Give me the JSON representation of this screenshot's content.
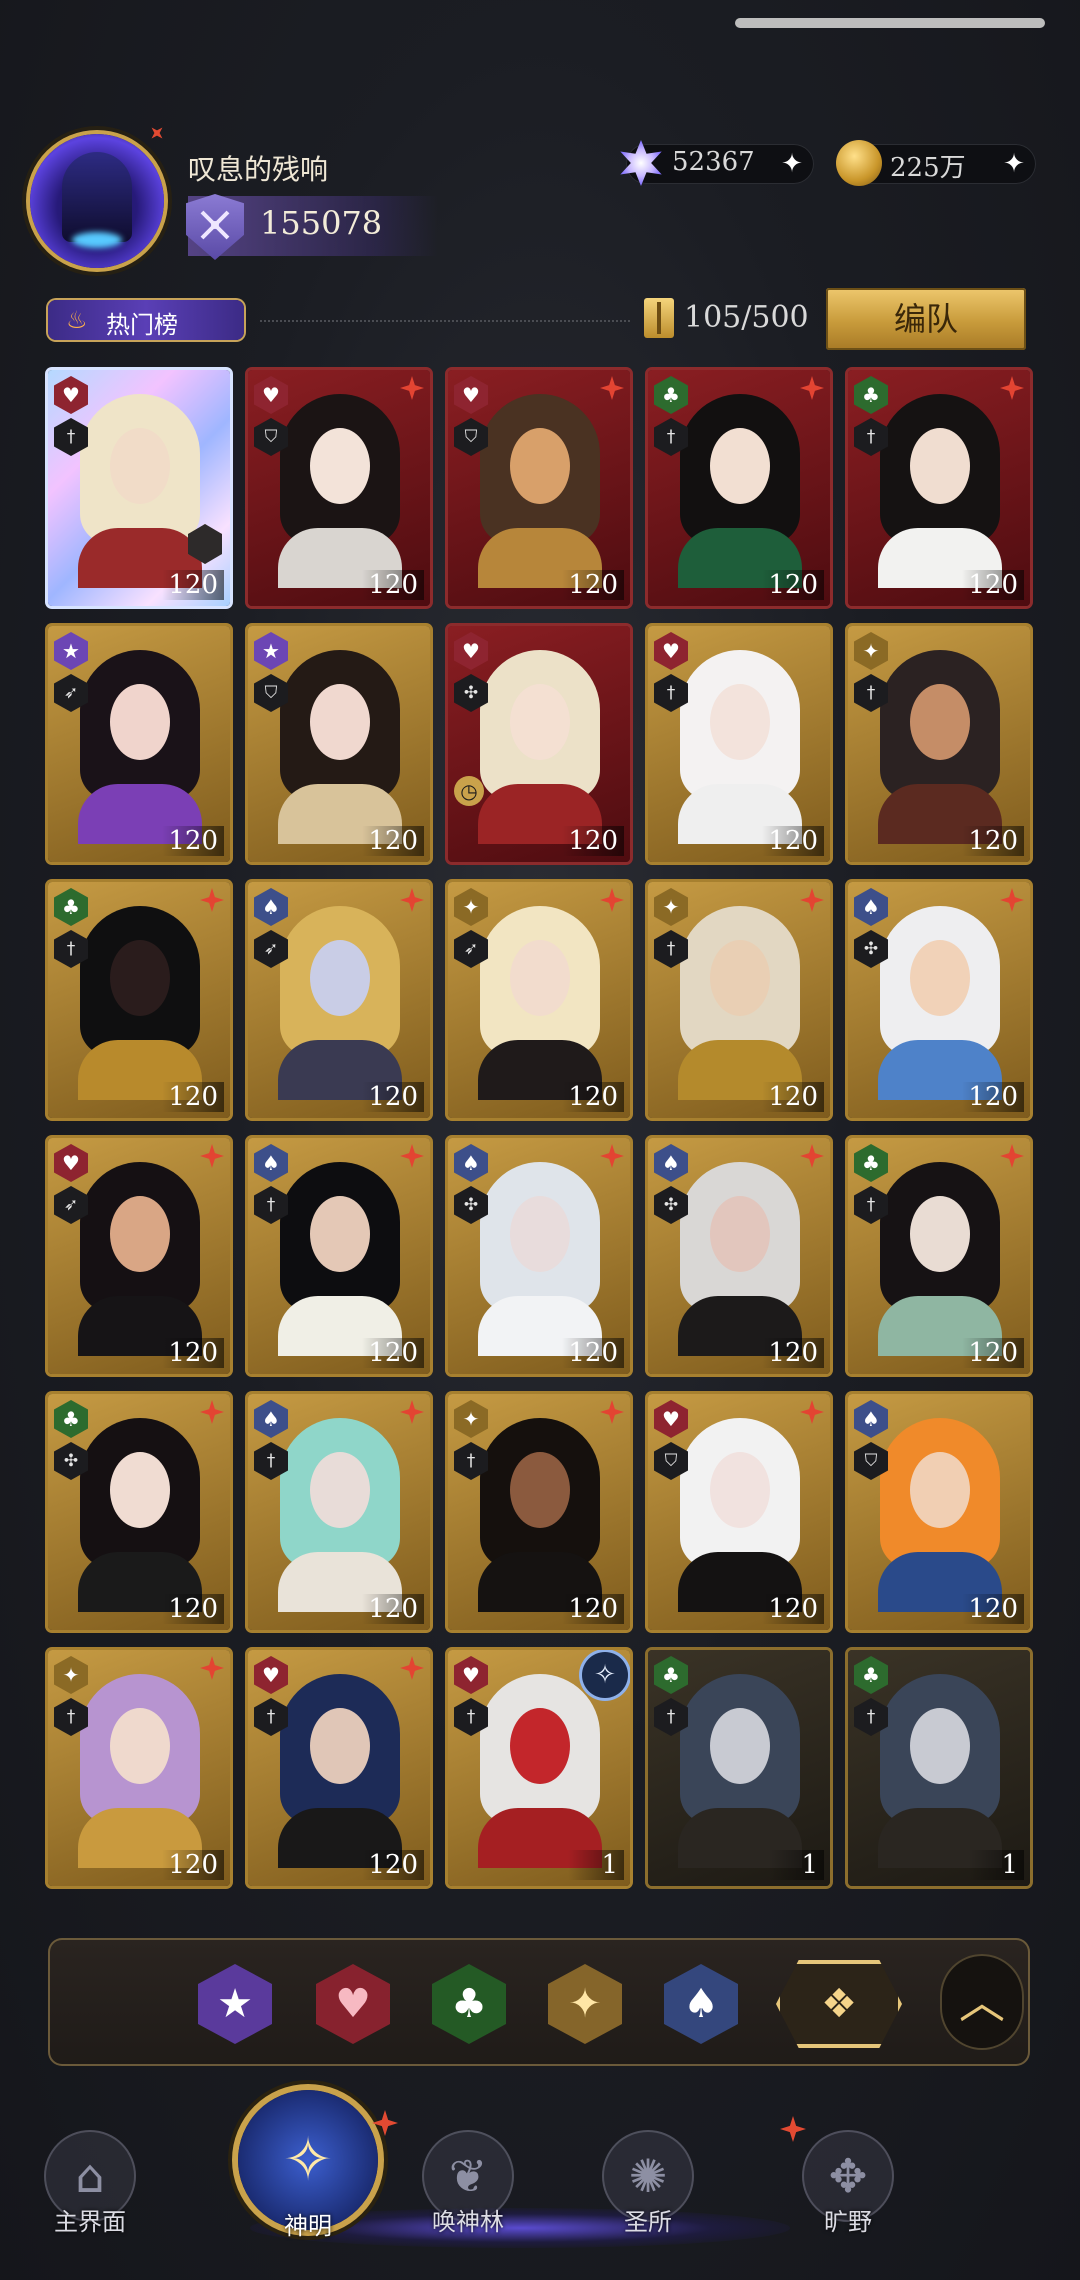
{
  "header": {
    "player_name": "叹息的残响",
    "power": "155078",
    "gems": "52367",
    "coins": "225万",
    "plus_icon": "plus-icon"
  },
  "toolbar": {
    "hot_list_label": "热门榜",
    "capacity": "105/500",
    "team_label": "编队"
  },
  "cards": [
    {
      "suit": "heart",
      "role": "sword",
      "level": "120",
      "frame": "holo",
      "new": false,
      "skin": "#f1dcc8",
      "hair": "#efe4c8",
      "body": "#9a2a2a"
    },
    {
      "suit": "heart",
      "role": "shield",
      "level": "120",
      "frame": "red",
      "new": true,
      "skin": "#f3e3d9",
      "hair": "#1b1414",
      "body": "#d9d5d0"
    },
    {
      "suit": "heart",
      "role": "shield",
      "level": "120",
      "frame": "red",
      "new": true,
      "skin": "#d8a06a",
      "hair": "#4a3222",
      "body": "#b7863a"
    },
    {
      "suit": "club",
      "role": "sword",
      "level": "120",
      "frame": "red",
      "new": true,
      "skin": "#f2dfd2",
      "hair": "#121010",
      "body": "#1e5e3a"
    },
    {
      "suit": "club",
      "role": "sword",
      "level": "120",
      "frame": "red",
      "new": true,
      "skin": "#f0ddd0",
      "hair": "#151212",
      "body": "#f2f2f0"
    },
    {
      "suit": "star",
      "role": "bow",
      "level": "120",
      "frame": "gold",
      "new": false,
      "skin": "#f0d4cc",
      "hair": "#1a1218",
      "body": "#7b3fb5"
    },
    {
      "suit": "star",
      "role": "shield",
      "level": "120",
      "frame": "gold",
      "new": false,
      "skin": "#f0d8cf",
      "hair": "#241a15",
      "body": "#d8c39a"
    },
    {
      "suit": "heart",
      "role": "staff",
      "level": "120",
      "frame": "red",
      "new": false,
      "skin": "#f4e0d2",
      "hair": "#ece1c8",
      "body": "#9b2425",
      "clock": true
    },
    {
      "suit": "heart",
      "role": "sword",
      "level": "120",
      "frame": "gold",
      "new": false,
      "skin": "#f3e3dc",
      "hair": "#f4f2f2",
      "body": "#efefef"
    },
    {
      "suit": "diamond",
      "role": "sword",
      "level": "120",
      "frame": "gold",
      "new": false,
      "skin": "#c58d67",
      "hair": "#2b2222",
      "body": "#5b2a20"
    },
    {
      "suit": "club",
      "role": "sword",
      "level": "120",
      "frame": "gold",
      "new": true,
      "skin": "#2a1c1c",
      "hair": "#0f0f10",
      "body": "#b88a2c"
    },
    {
      "suit": "spade",
      "role": "bow",
      "level": "120",
      "frame": "gold",
      "new": true,
      "skin": "#c9cde6",
      "hair": "#d8b35a",
      "body": "#3a3a52"
    },
    {
      "suit": "diamond",
      "role": "bow",
      "level": "120",
      "frame": "gold",
      "new": true,
      "skin": "#f2dccd",
      "hair": "#f2e5c2",
      "body": "#1f1a1a"
    },
    {
      "suit": "diamond",
      "role": "sword",
      "level": "120",
      "frame": "gold",
      "new": true,
      "skin": "#e9cfb4",
      "hair": "#e2d7c2",
      "body": "#b48a2c"
    },
    {
      "suit": "spade",
      "role": "staff",
      "level": "120",
      "frame": "gold",
      "new": true,
      "skin": "#f1d2b8",
      "hair": "#eeeef0",
      "body": "#4e82c9"
    },
    {
      "suit": "heart",
      "role": "bow",
      "level": "120",
      "frame": "gold",
      "new": true,
      "skin": "#d9a685",
      "hair": "#151013",
      "body": "#161416"
    },
    {
      "suit": "spade",
      "role": "sword",
      "level": "120",
      "frame": "gold",
      "new": true,
      "skin": "#e4c8b6",
      "hair": "#0d0d10",
      "body": "#f0efe6"
    },
    {
      "suit": "spade",
      "role": "staff",
      "level": "120",
      "frame": "gold",
      "new": true,
      "skin": "#e8dcdc",
      "hair": "#dfe4ea",
      "body": "#f2f3f5"
    },
    {
      "suit": "spade",
      "role": "staff",
      "level": "120",
      "frame": "gold",
      "new": true,
      "skin": "#e2c6bd",
      "hair": "#d9d7d5",
      "body": "#1c1a1a"
    },
    {
      "suit": "club",
      "role": "sword",
      "level": "120",
      "frame": "gold",
      "new": true,
      "skin": "#e9dcd3",
      "hair": "#161214",
      "body": "#8fb6a2"
    },
    {
      "suit": "club",
      "role": "staff",
      "level": "120",
      "frame": "gold",
      "new": true,
      "skin": "#f0dcd2",
      "hair": "#151012",
      "body": "#1a1a1a"
    },
    {
      "suit": "spade",
      "role": "sword",
      "level": "120",
      "frame": "gold",
      "new": true,
      "skin": "#e8dcd8",
      "hair": "#8fd6c9",
      "body": "#e9e3d9"
    },
    {
      "suit": "diamond",
      "role": "sword",
      "level": "120",
      "frame": "gold",
      "new": true,
      "skin": "#8b5a3e",
      "hair": "#15100d",
      "body": "#151211"
    },
    {
      "suit": "heart",
      "role": "shield",
      "level": "120",
      "frame": "gold",
      "new": true,
      "skin": "#f1e2df",
      "hair": "#f2f2f2",
      "body": "#141212"
    },
    {
      "suit": "spade",
      "role": "shield",
      "level": "120",
      "frame": "gold",
      "new": false,
      "skin": "#f1cfb3",
      "hair": "#f08a2a",
      "body": "#2a4a8a"
    },
    {
      "suit": "diamond",
      "role": "sword",
      "level": "120",
      "frame": "gold",
      "new": true,
      "skin": "#efd9cd",
      "hair": "#b794d0",
      "body": "#c99a3e"
    },
    {
      "suit": "heart",
      "role": "sword",
      "level": "120",
      "frame": "gold",
      "new": true,
      "skin": "#e0c6b7",
      "hair": "#1d2b57",
      "body": "#191818"
    },
    {
      "suit": "heart",
      "role": "sword",
      "level": "1",
      "frame": "gold",
      "new": false,
      "skin": "#c3262b",
      "hair": "#e6e4e2",
      "body": "#a51f22",
      "compass": true
    },
    {
      "suit": "club",
      "role": "sword",
      "level": "1",
      "frame": "dark",
      "new": false,
      "skin": "#c8cad2",
      "hair": "#3a4558",
      "body": "#2a2621"
    },
    {
      "suit": "club",
      "role": "sword",
      "level": "1",
      "frame": "dark",
      "new": false,
      "skin": "#c8cad2",
      "hair": "#3a4558",
      "body": "#2a2621"
    }
  ],
  "filters": [
    {
      "name": "filter-star",
      "glyph": "★",
      "cls": "f-star"
    },
    {
      "name": "filter-heart",
      "glyph": "♥",
      "cls": "f-heart"
    },
    {
      "name": "filter-club",
      "glyph": "♣",
      "cls": "f-club"
    },
    {
      "name": "filter-diamond",
      "glyph": "✦",
      "cls": "f-diamond"
    },
    {
      "name": "filter-spade",
      "glyph": "♠",
      "cls": "f-spade"
    },
    {
      "name": "filter-all",
      "glyph": "❖",
      "cls": "f-all"
    }
  ],
  "nav": [
    {
      "label": "主界面",
      "icon": "home-icon",
      "glyph": "⌂",
      "active": false
    },
    {
      "label": "神明",
      "icon": "gods-card-icon",
      "glyph": "✧",
      "active": true
    },
    {
      "label": "唤神林",
      "icon": "tree-icon",
      "glyph": "❦",
      "active": false
    },
    {
      "label": "圣所",
      "icon": "sanctuary-icon",
      "glyph": "✺",
      "active": false
    },
    {
      "label": "旷野",
      "icon": "compass-icon",
      "glyph": "✥",
      "active": false
    }
  ],
  "colors": {
    "accent_gold": "#c9a24b",
    "new_marker": "#e24a32"
  }
}
